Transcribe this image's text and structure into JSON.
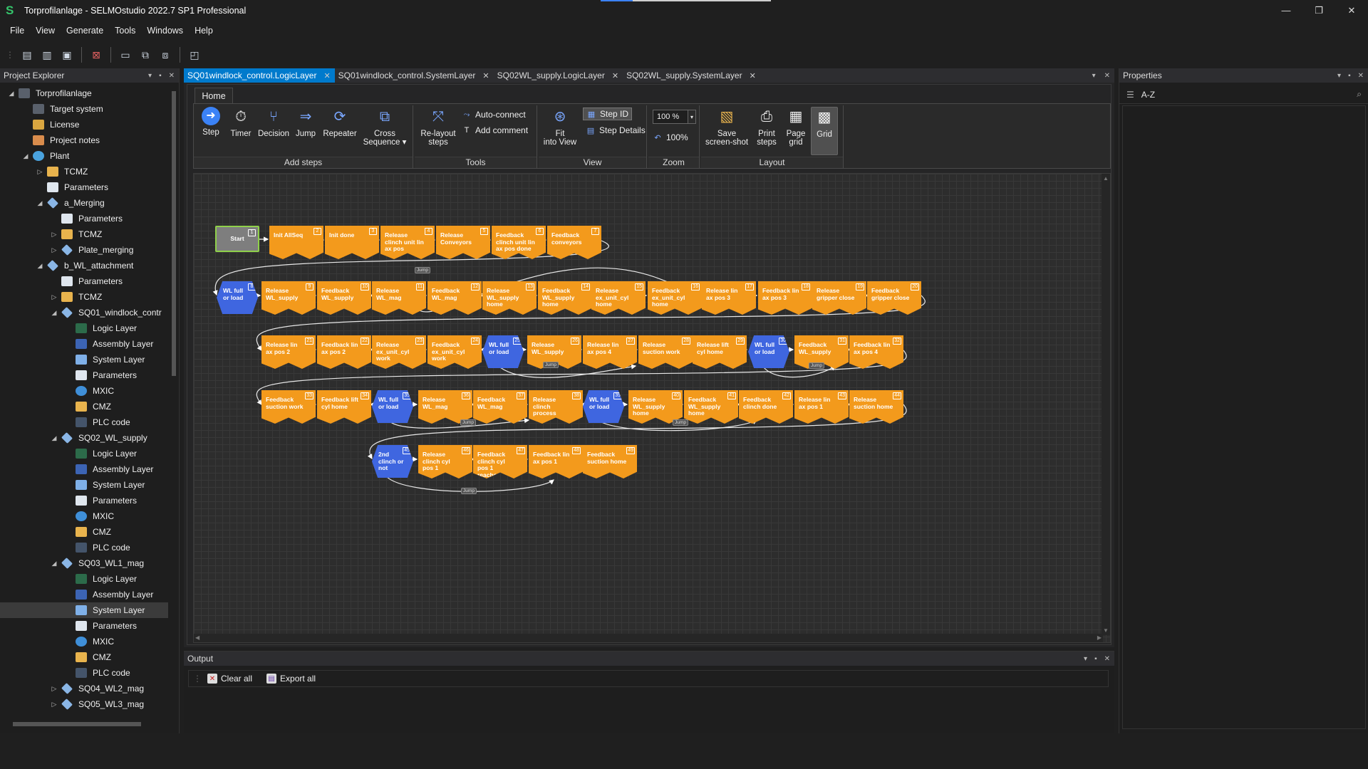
{
  "window": {
    "title": "Torprofilanlage - SELMOstudio 2022.7 SP1 Professional",
    "logo": "S",
    "controls": [
      "—",
      "❐",
      "✕"
    ]
  },
  "menu": [
    "File",
    "View",
    "Generate",
    "Tools",
    "Windows",
    "Help"
  ],
  "quick_toolbar": [
    "new-icon",
    "open-icon",
    "save-icon",
    "close-project-icon",
    "screen-icon",
    "code-icon",
    "code-gen-icon",
    "monitor-icon"
  ],
  "project_explorer": {
    "title": "Project Explorer",
    "items": [
      {
        "label": "Torprofilanlage",
        "depth": 0,
        "expander": "◢",
        "icon": "project-icon"
      },
      {
        "label": "Target system",
        "depth": 1,
        "expander": "",
        "icon": "target-system-icon"
      },
      {
        "label": "License",
        "depth": 1,
        "expander": "",
        "icon": "license-icon"
      },
      {
        "label": "Project notes",
        "depth": 1,
        "expander": "",
        "icon": "notes-icon"
      },
      {
        "label": "Plant",
        "depth": 1,
        "expander": "◢",
        "icon": "plant-icon"
      },
      {
        "label": "TCMZ",
        "depth": 2,
        "expander": "▷",
        "icon": "folder-icon"
      },
      {
        "label": "Parameters",
        "depth": 2,
        "expander": "",
        "icon": "parameters-icon"
      },
      {
        "label": "a_Merging",
        "depth": 2,
        "expander": "◢",
        "icon": "module-icon"
      },
      {
        "label": "Parameters",
        "depth": 3,
        "expander": "",
        "icon": "parameters-icon"
      },
      {
        "label": "TCMZ",
        "depth": 3,
        "expander": "▷",
        "icon": "folder-icon"
      },
      {
        "label": "Plate_merging",
        "depth": 3,
        "expander": "▷",
        "icon": "module-icon"
      },
      {
        "label": "b_WL_attachment",
        "depth": 2,
        "expander": "◢",
        "icon": "module-icon"
      },
      {
        "label": "Parameters",
        "depth": 3,
        "expander": "",
        "icon": "parameters-icon"
      },
      {
        "label": "TCMZ",
        "depth": 3,
        "expander": "▷",
        "icon": "folder-icon"
      },
      {
        "label": "SQ01_windlock_contr",
        "depth": 3,
        "expander": "◢",
        "icon": "module-icon"
      },
      {
        "label": "Logic Layer",
        "depth": 4,
        "expander": "",
        "icon": "logic-layer-icon"
      },
      {
        "label": "Assembly Layer",
        "depth": 4,
        "expander": "",
        "icon": "assembly-layer-icon"
      },
      {
        "label": "System Layer",
        "depth": 4,
        "expander": "",
        "icon": "system-layer-icon"
      },
      {
        "label": "Parameters",
        "depth": 4,
        "expander": "",
        "icon": "parameters-icon"
      },
      {
        "label": "MXIC",
        "depth": 4,
        "expander": "",
        "icon": "mxic-icon"
      },
      {
        "label": "CMZ",
        "depth": 4,
        "expander": "",
        "icon": "folder-icon"
      },
      {
        "label": "PLC code",
        "depth": 4,
        "expander": "",
        "icon": "plc-code-icon"
      },
      {
        "label": "SQ02_WL_supply",
        "depth": 3,
        "expander": "◢",
        "icon": "module-icon"
      },
      {
        "label": "Logic Layer",
        "depth": 4,
        "expander": "",
        "icon": "logic-layer-icon"
      },
      {
        "label": "Assembly Layer",
        "depth": 4,
        "expander": "",
        "icon": "assembly-layer-icon"
      },
      {
        "label": "System Layer",
        "depth": 4,
        "expander": "",
        "icon": "system-layer-icon"
      },
      {
        "label": "Parameters",
        "depth": 4,
        "expander": "",
        "icon": "parameters-icon"
      },
      {
        "label": "MXIC",
        "depth": 4,
        "expander": "",
        "icon": "mxic-icon"
      },
      {
        "label": "CMZ",
        "depth": 4,
        "expander": "",
        "icon": "folder-icon"
      },
      {
        "label": "PLC code",
        "depth": 4,
        "expander": "",
        "icon": "plc-code-icon"
      },
      {
        "label": "SQ03_WL1_mag",
        "depth": 3,
        "expander": "◢",
        "icon": "module-icon"
      },
      {
        "label": "Logic Layer",
        "depth": 4,
        "expander": "",
        "icon": "logic-layer-icon"
      },
      {
        "label": "Assembly Layer",
        "depth": 4,
        "expander": "",
        "icon": "assembly-layer-icon"
      },
      {
        "label": "System Layer",
        "depth": 4,
        "expander": "",
        "icon": "system-layer-icon",
        "selected": true
      },
      {
        "label": "Parameters",
        "depth": 4,
        "expander": "",
        "icon": "parameters-icon"
      },
      {
        "label": "MXIC",
        "depth": 4,
        "expander": "",
        "icon": "mxic-icon"
      },
      {
        "label": "CMZ",
        "depth": 4,
        "expander": "",
        "icon": "folder-icon"
      },
      {
        "label": "PLC code",
        "depth": 4,
        "expander": "",
        "icon": "plc-code-icon"
      },
      {
        "label": "SQ04_WL2_mag",
        "depth": 3,
        "expander": "▷",
        "icon": "module-icon"
      },
      {
        "label": "SQ05_WL3_mag",
        "depth": 3,
        "expander": "▷",
        "icon": "module-icon"
      }
    ]
  },
  "doc_tabs": [
    {
      "label": "SQ01windlock_control.LogicLayer",
      "active": true
    },
    {
      "label": "SQ01windlock_control.SystemLayer",
      "active": false
    },
    {
      "label": "SQ02WL_supply.LogicLayer",
      "active": false
    },
    {
      "label": "SQ02WL_supply.SystemLayer",
      "active": false
    }
  ],
  "ribbon": {
    "tab": "Home",
    "groups": {
      "add_steps": {
        "label": "Add steps",
        "step": "Step",
        "timer": "Timer",
        "decision": "Decision",
        "jump": "Jump",
        "repeater": "Repeater",
        "cross": "Cross",
        "cross2": "Sequence ▾"
      },
      "tools": {
        "label": "Tools",
        "relayout": "Re-layout",
        "relayout2": "steps",
        "autoconnect": "Auto-connect",
        "addcomment": "Add comment"
      },
      "view": {
        "label": "View",
        "fit": "Fit",
        "fit2": "into View",
        "stepid": "Step ID",
        "stepdetails": "Step Details"
      },
      "zoom": {
        "label": "Zoom",
        "value": "100 %",
        "reset": "100%"
      },
      "layout": {
        "label": "Layout",
        "save": "Save",
        "save2": "screen-shot",
        "print": "Print",
        "print2": "steps",
        "page": "Page",
        "page2": "grid",
        "grid": "Grid"
      }
    }
  },
  "flow": {
    "start": {
      "label": "Start",
      "id": "1"
    },
    "steps": [
      {
        "id": "2",
        "label": "Init AllSeq",
        "type": "step"
      },
      {
        "id": "3",
        "label": "Init done",
        "type": "step"
      },
      {
        "id": "4",
        "label": "Release clinch unit lin ax pos",
        "type": "step"
      },
      {
        "id": "5",
        "label": "Release Conveyors",
        "type": "step"
      },
      {
        "id": "6",
        "label": "Feedback clinch unit lin ax pos done",
        "type": "step"
      },
      {
        "id": "7",
        "label": "Feedback conveyors",
        "type": "step"
      },
      {
        "id": "8",
        "label": "WL full or load",
        "type": "decision"
      },
      {
        "id": "9",
        "label": "Release WL_supply",
        "type": "step"
      },
      {
        "id": "10",
        "label": "Feedback WL_supply",
        "type": "step"
      },
      {
        "id": "11",
        "label": "Release WL_mag",
        "type": "step"
      },
      {
        "id": "12",
        "label": "Feedback WL_mag",
        "type": "step"
      },
      {
        "id": "13",
        "label": "Release WL_supply home",
        "type": "step"
      },
      {
        "id": "14",
        "label": "Feedback WL_supply home",
        "type": "step"
      },
      {
        "id": "15",
        "label": "Release ex_unit_cyl home",
        "type": "step"
      },
      {
        "id": "16",
        "label": "Feedback ex_unit_cyl home",
        "type": "step"
      },
      {
        "id": "17",
        "label": "Release lin ax pos 3",
        "type": "step"
      },
      {
        "id": "18",
        "label": "Feedback lin ax pos 3",
        "type": "step"
      },
      {
        "id": "19",
        "label": "Release gripper close",
        "type": "step"
      },
      {
        "id": "20",
        "label": "Feedback gripper close",
        "type": "step"
      },
      {
        "id": "21",
        "label": "Release lin ax pos 2",
        "type": "step"
      },
      {
        "id": "22",
        "label": "Feedback lin ax pos 2",
        "type": "step"
      },
      {
        "id": "23",
        "label": "Release ex_unit_cyl work",
        "type": "step"
      },
      {
        "id": "24",
        "label": "Feedback ex_unit_cyl work",
        "type": "step"
      },
      {
        "id": "25",
        "label": "WL full or load",
        "type": "decision"
      },
      {
        "id": "26",
        "label": "Release WL_supply",
        "type": "step"
      },
      {
        "id": "27",
        "label": "Release lin ax pos 4",
        "type": "step"
      },
      {
        "id": "28",
        "label": "Release suction work",
        "type": "step"
      },
      {
        "id": "29",
        "label": "Release lift cyl home",
        "type": "step"
      },
      {
        "id": "30",
        "label": "WL full or load",
        "type": "decision"
      },
      {
        "id": "31",
        "label": "Feedback WL_supply",
        "type": "step"
      },
      {
        "id": "32",
        "label": "Feedback lin ax pos 4",
        "type": "step"
      },
      {
        "id": "33",
        "label": "Feedback suction work",
        "type": "step"
      },
      {
        "id": "34",
        "label": "Feedback lift cyl home",
        "type": "step"
      },
      {
        "id": "35",
        "label": "WL full or load",
        "type": "decision"
      },
      {
        "id": "36",
        "label": "Release WL_mag",
        "type": "step"
      },
      {
        "id": "37",
        "label": "Feedback WL_mag",
        "type": "step"
      },
      {
        "id": "38",
        "label": "Release clinch process",
        "type": "step"
      },
      {
        "id": "39",
        "label": "WL full or load",
        "type": "decision"
      },
      {
        "id": "40",
        "label": "Release WL_supply home",
        "type": "step"
      },
      {
        "id": "41",
        "label": "Feedback WL_supply home",
        "type": "step"
      },
      {
        "id": "42",
        "label": "Feedback clinch done",
        "type": "step"
      },
      {
        "id": "43",
        "label": "Release lin ax pos 1",
        "type": "step"
      },
      {
        "id": "44",
        "label": "Release suction home",
        "type": "step"
      },
      {
        "id": "45",
        "label": "2nd clinch or not",
        "type": "decision"
      },
      {
        "id": "46",
        "label": "Release clinch cyl pos 1",
        "type": "step"
      },
      {
        "id": "47",
        "label": "Feedback clinch cyl pos 1 reached",
        "type": "step"
      },
      {
        "id": "48",
        "label": "Feedback lin ax pos 1",
        "type": "step"
      },
      {
        "id": "49",
        "label": "Feedback suction home",
        "type": "step"
      }
    ],
    "jump_label": "Jump",
    "colors": {
      "step": "#f39a1c",
      "decision": "#3f66e0",
      "start": "#7e7e7e",
      "start_border": "#8fd04a",
      "connector": "#ffffff"
    }
  },
  "output": {
    "title": "Output",
    "clear_all": "Clear all",
    "export_all": "Export all"
  },
  "properties": {
    "title": "Properties",
    "sort": "A-Z"
  },
  "accent": "#007acc"
}
